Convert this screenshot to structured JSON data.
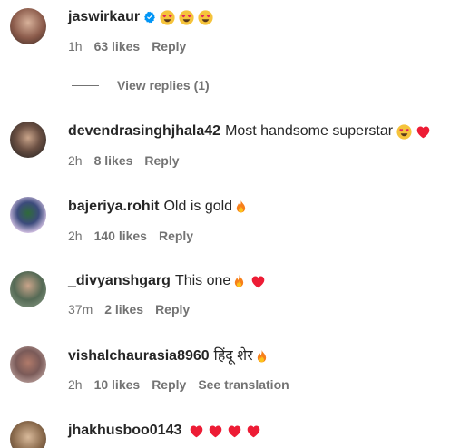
{
  "comments": [
    {
      "username": "jaswirkaur",
      "verified": true,
      "text": "",
      "emojis": [
        "heart-eyes",
        "heart-eyes",
        "heart-eyes"
      ],
      "time": "1h",
      "likes": "63 likes",
      "reply": "Reply",
      "avatar_color": "#8a5a4a"
    },
    {
      "username": "devendrasinghjhala42",
      "text": "Most handsome superstar",
      "emojis": [
        "heart-eyes",
        "red-heart"
      ],
      "time": "2h",
      "likes": "8 likes",
      "reply": "Reply",
      "avatar_color": "#3b3b3b"
    },
    {
      "username": "bajeriya.rohit",
      "text": "Old is gold",
      "emojis": [
        "fire"
      ],
      "time": "2h",
      "likes": "140 likes",
      "reply": "Reply",
      "avatar_color": "#d8c5e6"
    },
    {
      "username": "_divyanshgarg",
      "text": "This one",
      "emojis": [
        "fire",
        "red-heart"
      ],
      "time": "37m",
      "likes": "2 likes",
      "reply": "Reply",
      "avatar_color": "#6b7d6a"
    },
    {
      "username": "vishalchaurasia8960",
      "text": "हिंदू शेर",
      "emojis": [
        "fire"
      ],
      "time": "2h",
      "likes": "10 likes",
      "reply": "Reply",
      "translation": "See translation",
      "avatar_color": "#c9a8a0"
    },
    {
      "username": "jhakhusboo0143",
      "text": "",
      "emojis": [
        "red-heart",
        "red-heart",
        "red-heart",
        "red-heart"
      ],
      "avatar_color": "#a58a6c"
    }
  ],
  "view_replies": "View replies (1)",
  "colors": {
    "text": "#262626",
    "secondary": "#737373",
    "verified": "#0095f6",
    "heart": "#ed1c35",
    "fire": "#f77f1a"
  }
}
